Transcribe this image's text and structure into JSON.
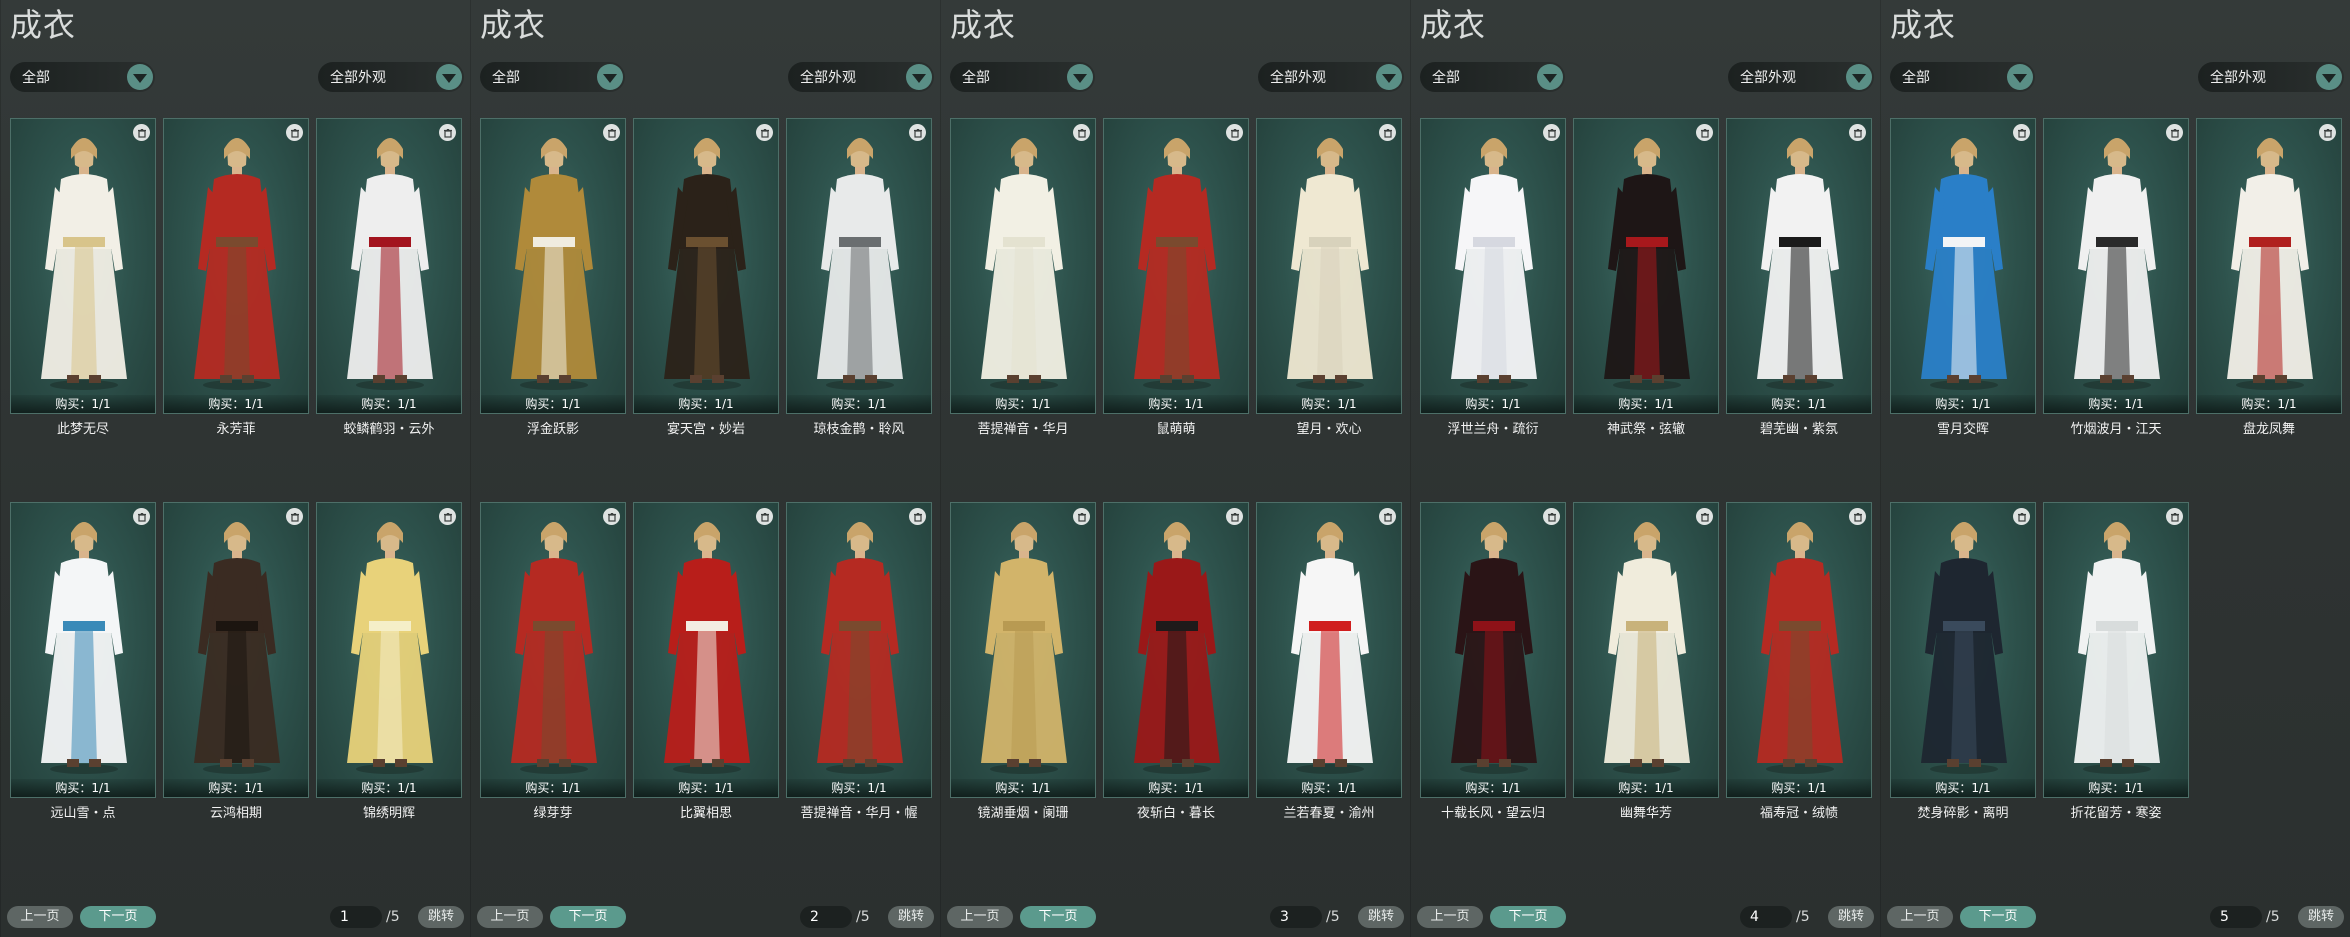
{
  "colors": {
    "accent": "#5b9a8d",
    "card_bg": "#2e534d",
    "card_border": "#4d6f68",
    "page_bg": "#2c3130"
  },
  "icons": {
    "trash": "trash-icon",
    "dropdown": "chevron-down-icon"
  },
  "panels": [
    {
      "title": "成衣",
      "category_filter": "全部",
      "appearance_filter": "全部外观",
      "prev_label": "上一页",
      "next_label": "下一页",
      "jump_label": "跳转",
      "page": "1",
      "page_total": "/5",
      "items": [
        {
          "name": "此梦无尽",
          "buy": "购买：1/1",
          "c1": "#f2efe6",
          "c2": "#d8c48a"
        },
        {
          "name": "永芳菲",
          "buy": "购买：1/1",
          "c1": "#b52a22",
          "c2": "#7a4a2e"
        },
        {
          "name": "蛟鳞鹤羽・云外",
          "buy": "购买：1/1",
          "c1": "#eeeeee",
          "c2": "#a3141e"
        },
        {
          "name": "远山雪・点",
          "buy": "购买：1/1",
          "c1": "#f4f6f7",
          "c2": "#3a8ab8"
        },
        {
          "name": "云鸿相期",
          "buy": "购买：1/1",
          "c1": "#3a2b22",
          "c2": "#1c1510"
        },
        {
          "name": "锦绣明辉",
          "buy": "购买：1/1",
          "c1": "#e8d27a",
          "c2": "#f5efc8"
        }
      ]
    },
    {
      "title": "成衣",
      "category_filter": "全部",
      "appearance_filter": "全部外观",
      "prev_label": "上一页",
      "next_label": "下一页",
      "jump_label": "跳转",
      "page": "2",
      "page_total": "/5",
      "items": [
        {
          "name": "浮金跃影",
          "buy": "购买：1/1",
          "c1": "#b08a3a",
          "c2": "#f0ece0"
        },
        {
          "name": "宴天宫・妙岩",
          "buy": "购买：1/1",
          "c1": "#2b2219",
          "c2": "#6b5030"
        },
        {
          "name": "琼枝金鹊・聆风",
          "buy": "购买：1/1",
          "c1": "#e8eaea",
          "c2": "#6a6e70"
        },
        {
          "name": "绿芽芽",
          "buy": "购买：1/1",
          "c1": "#b52a22",
          "c2": "#7a4a2e"
        },
        {
          "name": "比翼相思",
          "buy": "购买：1/1",
          "c1": "#b81e1a",
          "c2": "#f3ede2"
        },
        {
          "name": "菩提禅音・华月・幄",
          "buy": "购买：1/1",
          "c1": "#b52a22",
          "c2": "#7a4a2e"
        }
      ]
    },
    {
      "title": "成衣",
      "category_filter": "全部",
      "appearance_filter": "全部外观",
      "prev_label": "上一页",
      "next_label": "下一页",
      "jump_label": "跳转",
      "page": "3",
      "page_total": "/5",
      "items": [
        {
          "name": "菩提禅音・华月",
          "buy": "购买：1/1",
          "c1": "#f2f0e4",
          "c2": "#e4e2d0"
        },
        {
          "name": "鼠萌萌",
          "buy": "购买：1/1",
          "c1": "#b52a22",
          "c2": "#7a4a2e"
        },
        {
          "name": "望月・欢心",
          "buy": "购买：1/1",
          "c1": "#efe8d2",
          "c2": "#d8d2bc"
        },
        {
          "name": "镜湖垂烟・阑珊",
          "buy": "购买：1/1",
          "c1": "#d2b46a",
          "c2": "#b89a52"
        },
        {
          "name": "夜斩白・暮长",
          "buy": "购买：1/1",
          "c1": "#9a1818",
          "c2": "#1e1a1a"
        },
        {
          "name": "兰若春夏・渝州",
          "buy": "购买：1/1",
          "c1": "#f6f6f6",
          "c2": "#d01e1e"
        }
      ]
    },
    {
      "title": "成衣",
      "category_filter": "全部",
      "appearance_filter": "全部外观",
      "prev_label": "上一页",
      "next_label": "下一页",
      "jump_label": "跳转",
      "page": "4",
      "page_total": "/5",
      "items": [
        {
          "name": "浮世兰舟・疏衍",
          "buy": "购买：1/1",
          "c1": "#f6f6f8",
          "c2": "#d6d8e0"
        },
        {
          "name": "神武祭・弦辙",
          "buy": "购买：1/1",
          "c1": "#1e1616",
          "c2": "#a8181c"
        },
        {
          "name": "碧芜幽・紫氛",
          "buy": "购买：1/1",
          "c1": "#f2f2f2",
          "c2": "#1a1a1a"
        },
        {
          "name": "十载长风・望云归",
          "buy": "购买：1/1",
          "c1": "#2a1416",
          "c2": "#8e1218"
        },
        {
          "name": "幽舞华芳",
          "buy": "购买：1/1",
          "c1": "#f0ecdc",
          "c2": "#c8b27a"
        },
        {
          "name": "福寿冠・绒帻",
          "buy": "购买：1/1",
          "c1": "#b52a22",
          "c2": "#7a4a2e"
        }
      ]
    },
    {
      "title": "成衣",
      "category_filter": "全部",
      "appearance_filter": "全部外观",
      "prev_label": "上一页",
      "next_label": "下一页",
      "jump_label": "跳转",
      "page": "5",
      "page_total": "/5",
      "items": [
        {
          "name": "雪月交晖",
          "buy": "购买：1/1",
          "c1": "#2a7fc8",
          "c2": "#f2f4f6"
        },
        {
          "name": "竹烟波月・江天",
          "buy": "购买：1/1",
          "c1": "#f0f0f0",
          "c2": "#2a2a2a"
        },
        {
          "name": "盘龙凤舞",
          "buy": "购买：1/1",
          "c1": "#f2efe8",
          "c2": "#b0201e"
        },
        {
          "name": "焚身碎影・离明",
          "buy": "购买：1/1",
          "c1": "#1e2630",
          "c2": "#3a4a5c"
        },
        {
          "name": "折花留芳・寒姿",
          "buy": "购买：1/1",
          "c1": "#f0f2f2",
          "c2": "#d8dcdc"
        }
      ]
    }
  ]
}
